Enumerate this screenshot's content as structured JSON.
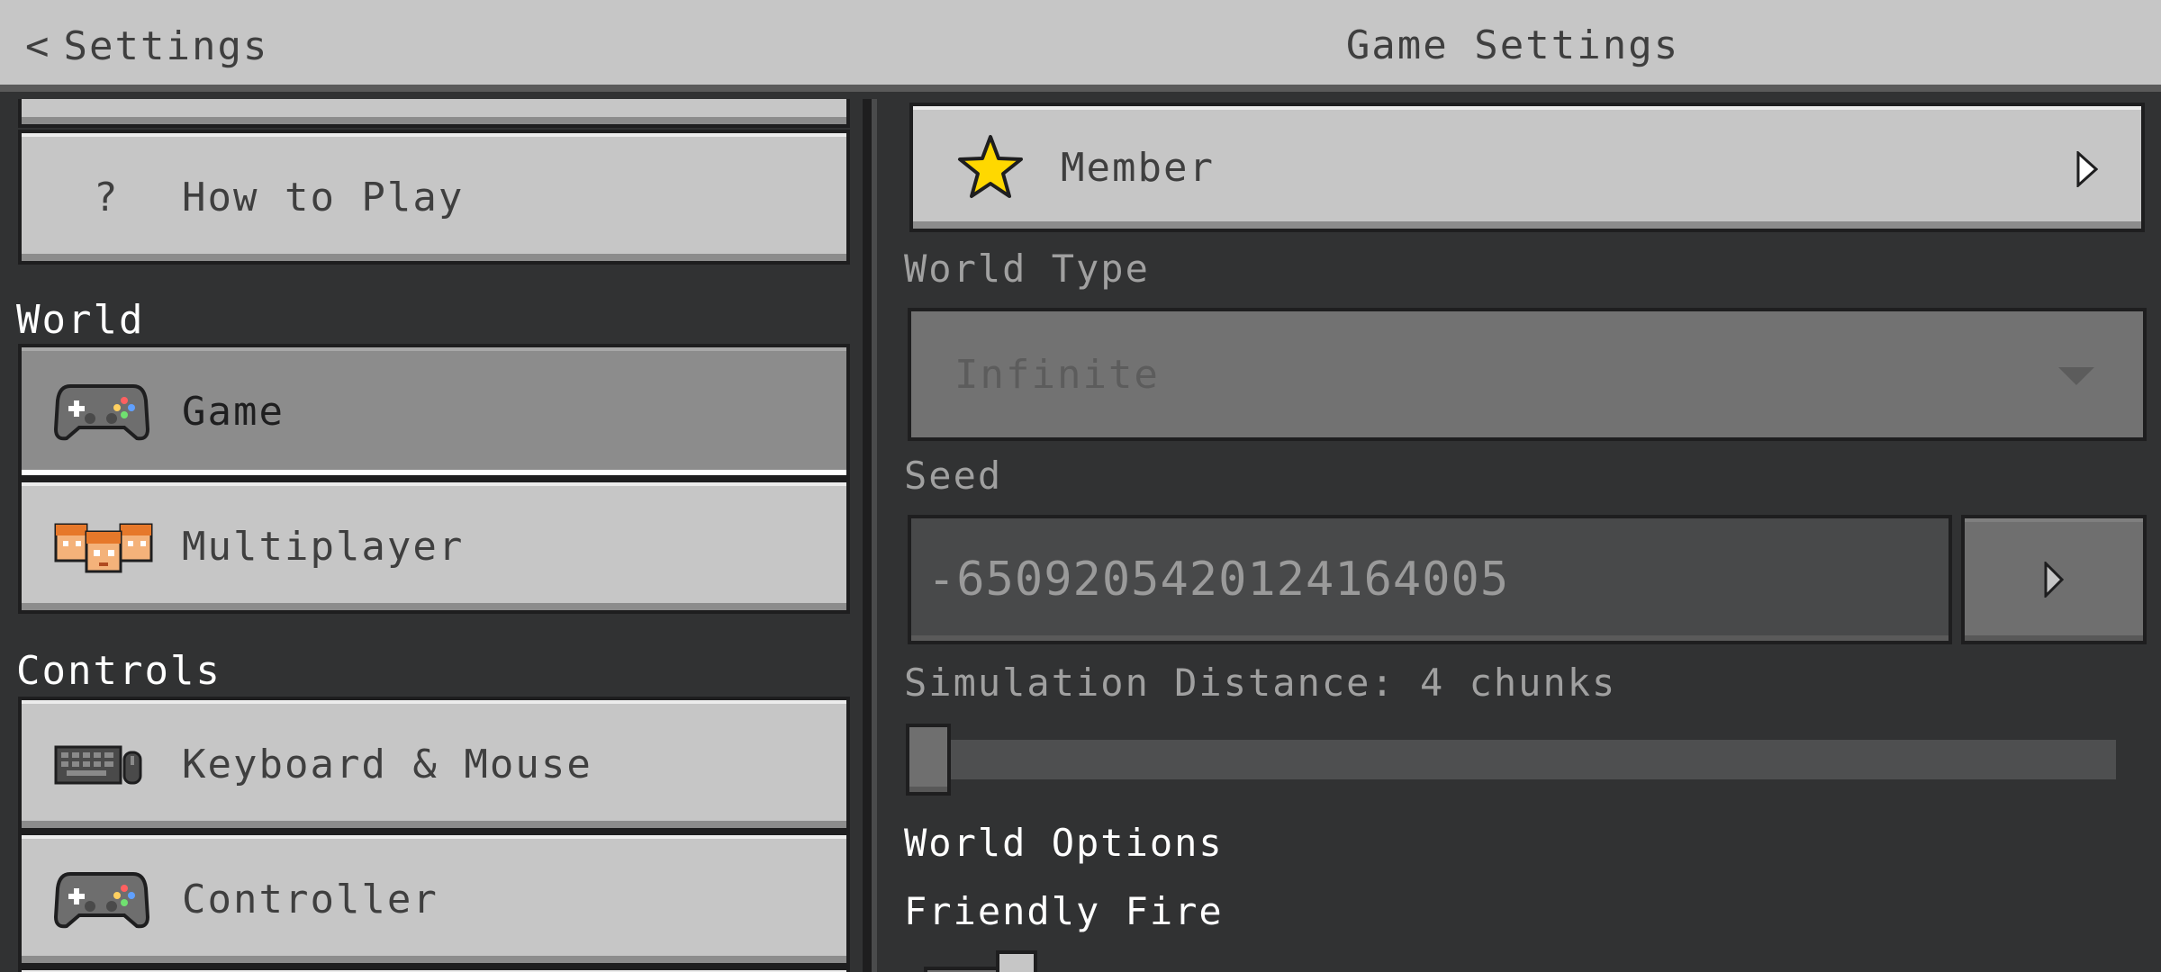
{
  "header": {
    "back_label": "Settings",
    "title": "Game Settings"
  },
  "sidebar": {
    "items": [
      {
        "label": "How to Play",
        "icon": "question-icon"
      },
      {
        "label": "Game",
        "icon": "controller-icon",
        "selected": true
      },
      {
        "label": "Multiplayer",
        "icon": "players-icon"
      },
      {
        "label": "Keyboard & Mouse",
        "icon": "keyboard-mouse-icon"
      },
      {
        "label": "Controller",
        "icon": "controller-icon"
      }
    ],
    "sections": {
      "world": "World",
      "controls": "Controls"
    }
  },
  "main": {
    "member": {
      "label": "Member",
      "icon": "star-icon"
    },
    "world_type": {
      "label": "World Type",
      "value": "Infinite"
    },
    "seed": {
      "label": "Seed",
      "value": "-6509205420124164005"
    },
    "simulation_distance": {
      "label": "Simulation Distance: 4 chunks",
      "value_chunks": 4
    },
    "world_options_heading": "World Options",
    "friendly_fire": {
      "label": "Friendly Fire",
      "on": true
    }
  },
  "colors": {
    "button": "#c6c6c6",
    "button_selected": "#8c8c8c",
    "background": "#313233",
    "border": "#1e1e1f",
    "star": "#ffd800"
  }
}
